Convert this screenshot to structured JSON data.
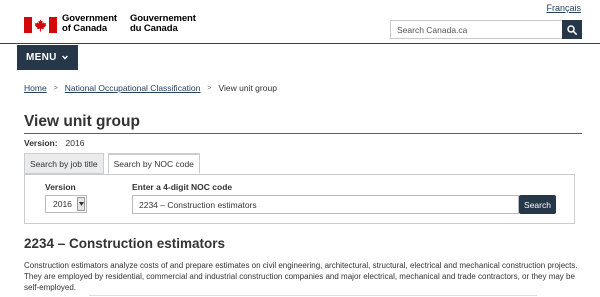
{
  "header": {
    "language_link": "Français",
    "signature_en_line1": "Government",
    "signature_en_line2": "of Canada",
    "signature_fr_line1": "Gouvernement",
    "signature_fr_line2": "du Canada",
    "search_placeholder": "Search Canada.ca",
    "search_icon": "magnifier-icon",
    "flag_color": "#d3080c",
    "brand_color": "#26374a"
  },
  "nav": {
    "menu_label": "MENU",
    "menu_icon": "chevron-down-icon"
  },
  "breadcrumb": {
    "items": [
      "Home",
      "National Occupational Classification"
    ],
    "current": "View unit group",
    "separator": ">"
  },
  "main": {
    "title": "View unit group",
    "version_label": "Version:",
    "version_value": "2016",
    "tabs": [
      {
        "label": "Search by job title",
        "active": false
      },
      {
        "label": "Search by NOC code",
        "active": true
      }
    ],
    "form": {
      "version_label": "Version",
      "version_selected": "2016",
      "noc_label": "Enter a 4-digit NOC code",
      "noc_value": "2234 – Construction estimators",
      "search_button": "Search"
    },
    "unit_group_title": "2234 – Construction estimators",
    "description": "Construction estimators analyze costs of and prepare estimates on civil engineering, architectural, structural, electrical and mechanical construction projects. They are employed by residential, commercial and industrial construction companies and major electrical, mechanical and trade contractors, or they may be self-employed."
  }
}
